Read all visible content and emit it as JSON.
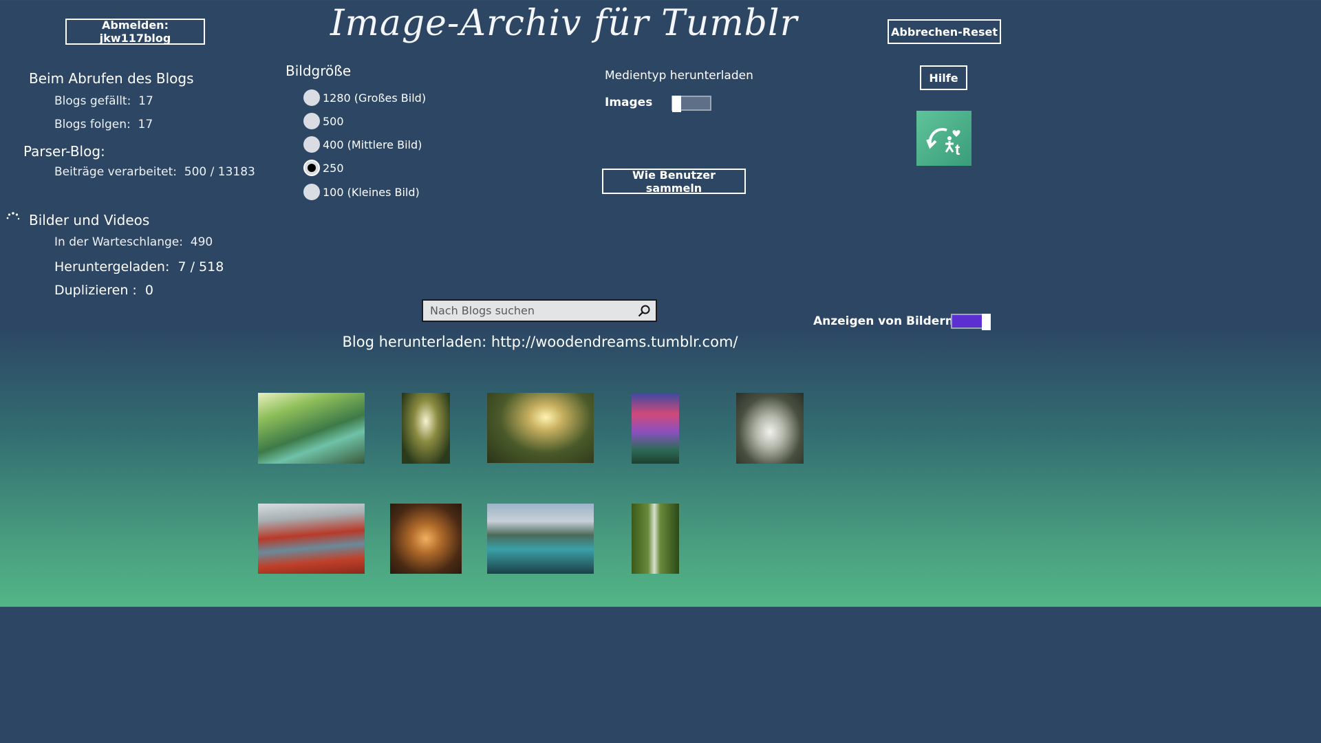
{
  "header": {
    "title": "Image-Archiv für Tumblr",
    "logout_label": "Abmelden: jkw117blog",
    "reset_label": "Abbrechen-Reset",
    "help_label": "Hilfe"
  },
  "status": {
    "fetch_heading": "Beim Abrufen des Blogs",
    "likes_label": "Blogs gefällt:",
    "likes_value": "17",
    "follows_label": "Blogs folgen:",
    "follows_value": "17",
    "parser_heading": "Parser-Blog:",
    "posts_label": "Beiträge verarbeitet:",
    "posts_value": "500 / 13183",
    "media_heading": "Bilder und Videos",
    "queue_label": "In der Warteschlange:",
    "queue_value": "490",
    "downloaded_label": "Heruntergeladen:",
    "downloaded_value": "7 / 518",
    "duplicates_label": "Duplizieren :",
    "duplicates_value": "0"
  },
  "size": {
    "heading": "Bildgröße",
    "options": [
      "1280 (Großes Bild)",
      "500",
      "400 (Mittlere Bild)",
      "250",
      "100 (Kleines Bild)"
    ],
    "selected": "250"
  },
  "media": {
    "heading": "Medientyp herunterladen",
    "type_label": "Images",
    "collect_label": "Wie Benutzer sammeln"
  },
  "search": {
    "placeholder": "Nach Blogs suchen"
  },
  "display": {
    "label": "Anzeigen von Bildern",
    "accent": "#5b2fd0"
  },
  "download": {
    "text": "Blog herunterladen: http://woodendreams.tumblr.com/"
  },
  "icons": {
    "spinner": "loading-spinner-icon",
    "search": "search-icon",
    "logo": "app-logo-icon"
  }
}
